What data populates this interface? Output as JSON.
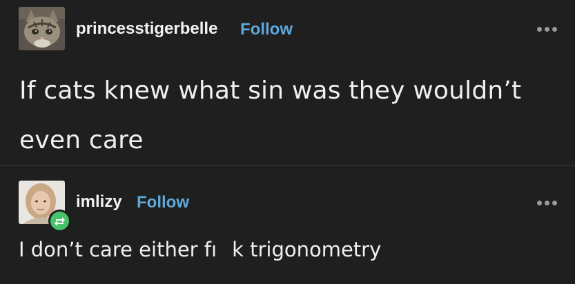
{
  "posts": [
    {
      "username": "princesstigerbelle",
      "follow_label": "Follow",
      "text": "If cats knew what sin was they wouldn’t even care",
      "avatar": "cat-avatar-icon",
      "more_icon": "more-options-icon"
    },
    {
      "username": "imlizy",
      "follow_label": "Follow",
      "text_part1": "I don’t care either fı",
      "text_part2": "k trigonometry",
      "avatar": "person-avatar-icon",
      "badge_icon": "reblog-icon",
      "more_icon": "more-options-icon"
    }
  ],
  "colors": {
    "background": "#1f1f1f",
    "follow": "#5ea9dd",
    "reblog_badge": "#47c36b",
    "divider": "#3a3a3a"
  }
}
